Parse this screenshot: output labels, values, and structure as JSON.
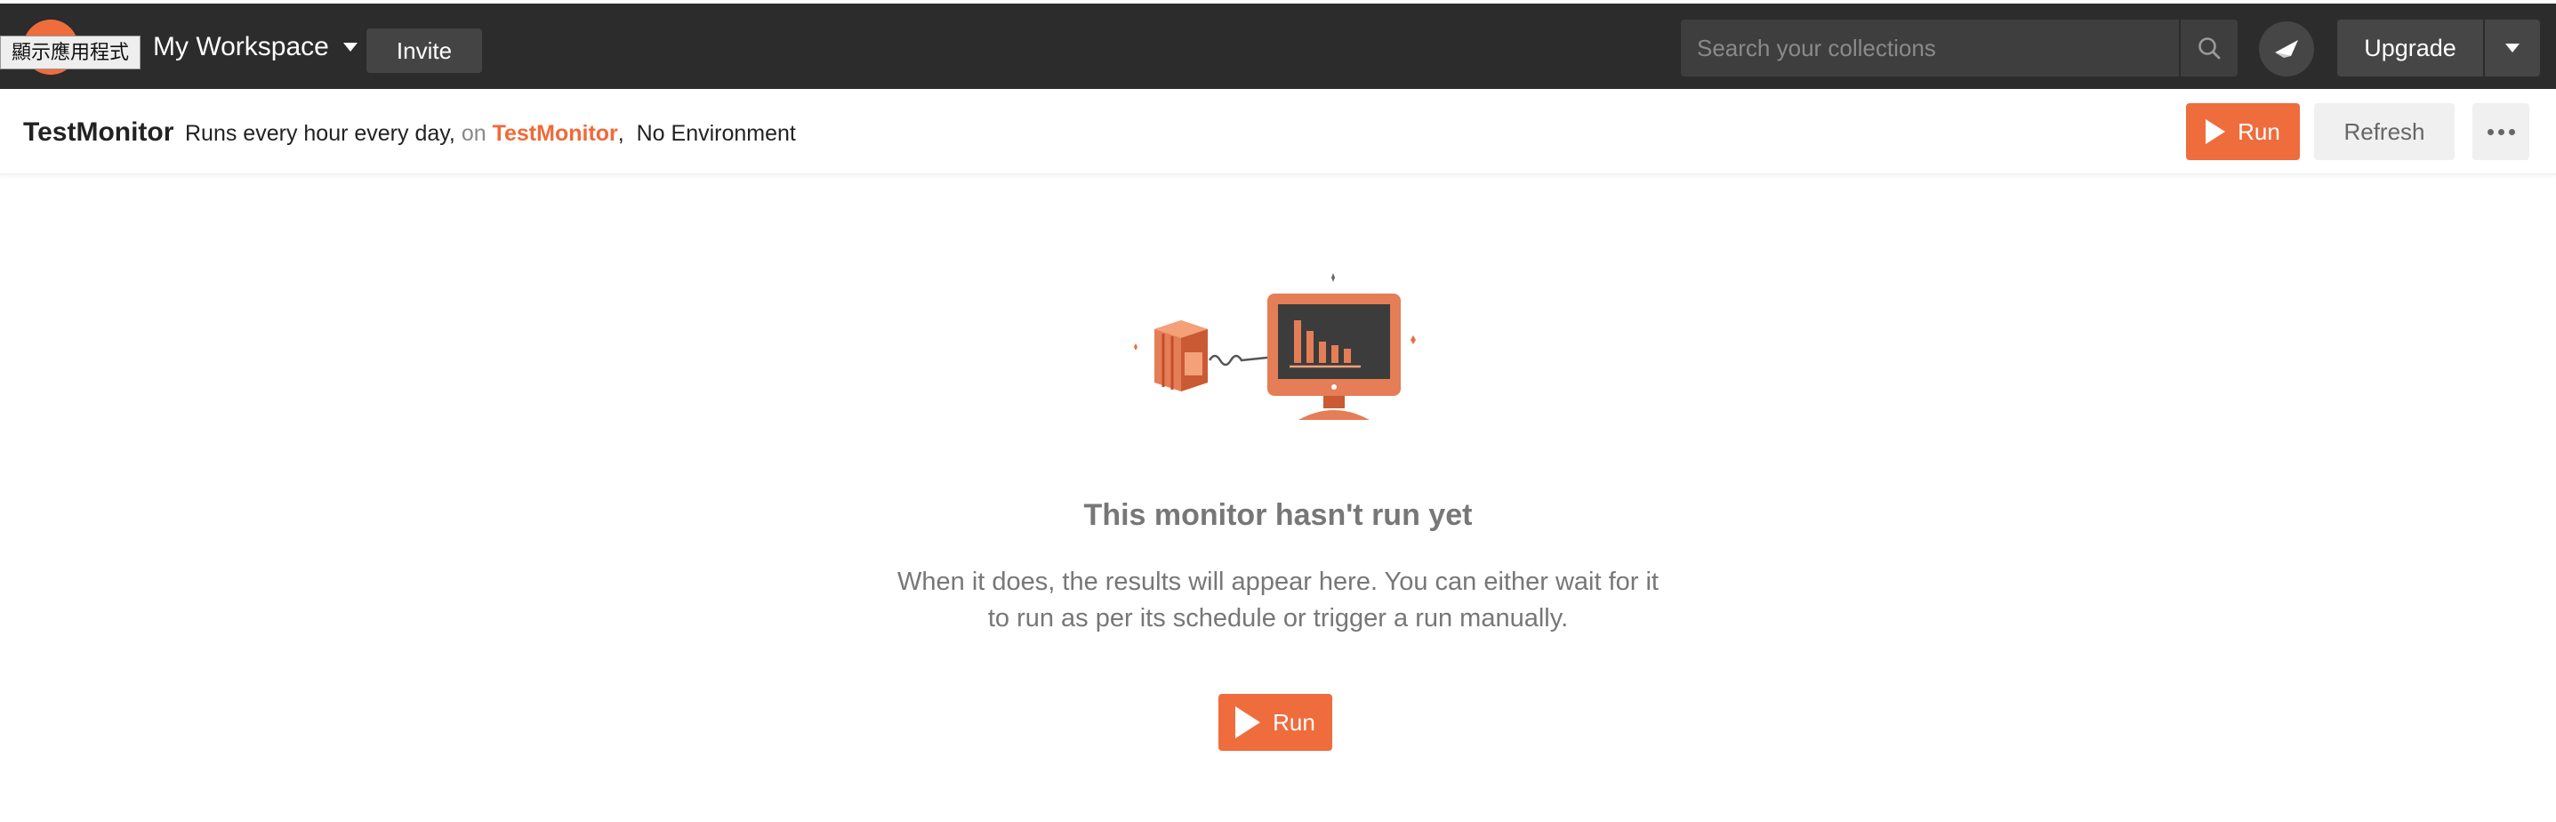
{
  "header": {
    "tooltip": "顯示應用程式",
    "workspace_label": "My Workspace",
    "invite_label": "Invite",
    "search_placeholder": "Search your collections",
    "upgrade_label": "Upgrade"
  },
  "monitor": {
    "name": "TestMonitor",
    "schedule": "Runs every hour every day,",
    "on_label": "on",
    "collection": "TestMonitor",
    "separator": ",",
    "environment": "No Environment",
    "run_label": "Run",
    "refresh_label": "Refresh"
  },
  "empty_state": {
    "title": "This monitor hasn't run yet",
    "body": "When it does, the results will appear here. You can either wait for it to run as per its schedule or trigger a run manually.",
    "run_label": "Run"
  },
  "icons": {
    "logo": "postman-logo-icon",
    "workspace_caret": "chevron-down-icon",
    "search": "search-icon",
    "send": "satellite-dish-icon",
    "upgrade_caret": "chevron-down-icon",
    "play": "play-icon",
    "more": "ellipsis-icon",
    "illustration": "monitor-illustration"
  },
  "colors": {
    "brand": "#ef6c3d",
    "topbar": "#2c2c2c",
    "text_muted": "#777777"
  }
}
